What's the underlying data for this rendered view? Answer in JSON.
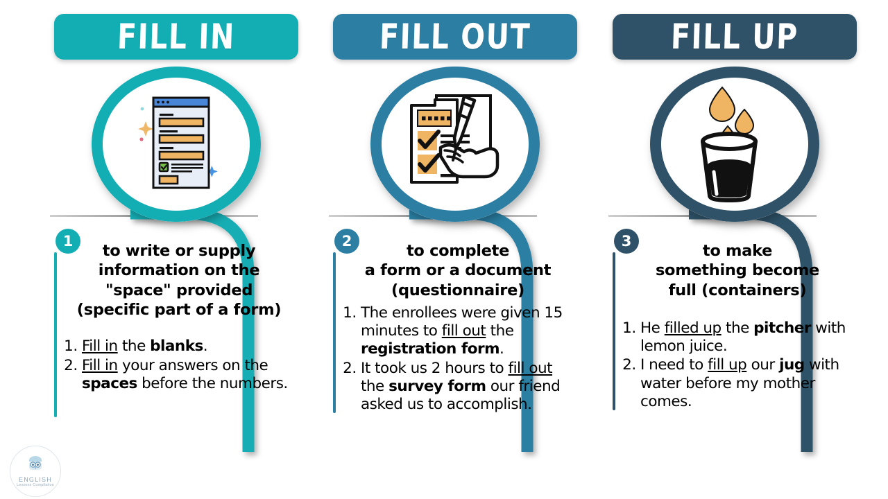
{
  "page": {
    "title": "Fill in / Fill out / Fill up",
    "background": "#ffffff"
  },
  "colors": {
    "teal": "#12AEB4",
    "blue": "#2C7FA3",
    "navy": "#2F5269",
    "orange": "#EFB562",
    "green": "#79C04A",
    "window_bar": "#4A86D8",
    "window_body": "#E8EEF8",
    "ink": "#000000",
    "rule_gray": "#9a9a9a"
  },
  "columns": [
    {
      "id": "fill-in",
      "header": "FILL IN",
      "accent": "#12AEB4",
      "number": "1",
      "icon": "online-form-window-icon",
      "definition": [
        "to write or supply",
        "information on the",
        "\"space\" provided",
        "(specific part of a form)"
      ],
      "examples": [
        {
          "parts": [
            {
              "t": "Fill in",
              "style": "underline"
            },
            {
              "t": " the ",
              "style": "plain"
            },
            {
              "t": "blanks",
              "style": "bold"
            },
            {
              "t": ".",
              "style": "plain"
            }
          ]
        },
        {
          "parts": [
            {
              "t": "Fill in",
              "style": "underline"
            },
            {
              "t": " your answers on the ",
              "style": "plain"
            },
            {
              "t": "spaces",
              "style": "bold"
            },
            {
              "t": " before the numbers.",
              "style": "plain"
            }
          ]
        }
      ]
    },
    {
      "id": "fill-out",
      "header": "FILL OUT",
      "accent": "#2C7FA3",
      "number": "2",
      "icon": "clipboard-hand-pen-icon",
      "definition": [
        "to complete",
        "a form or a document",
        "(questionnaire)"
      ],
      "examples": [
        {
          "parts": [
            {
              "t": "The enrollees were given 15 minutes to ",
              "style": "plain"
            },
            {
              "t": "fill out",
              "style": "underline"
            },
            {
              "t": " the ",
              "style": "plain"
            },
            {
              "t": "registration form",
              "style": "bold"
            },
            {
              "t": ".",
              "style": "plain"
            }
          ]
        },
        {
          "parts": [
            {
              "t": "It took us 2 hours to ",
              "style": "plain"
            },
            {
              "t": "fill out",
              "style": "underline"
            },
            {
              "t": " the ",
              "style": "plain"
            },
            {
              "t": "survey form",
              "style": "bold"
            },
            {
              "t": " our friend asked us to accomplish.",
              "style": "plain"
            }
          ]
        }
      ]
    },
    {
      "id": "fill-up",
      "header": "FILL UP",
      "accent": "#2F5269",
      "number": "3",
      "icon": "glass-filling-droplets-icon",
      "definition": [
        "to make",
        "something become",
        "full (containers)"
      ],
      "examples": [
        {
          "parts": [
            {
              "t": "He ",
              "style": "plain"
            },
            {
              "t": "filled up",
              "style": "underline"
            },
            {
              "t": " the ",
              "style": "plain"
            },
            {
              "t": "pitcher",
              "style": "bold"
            },
            {
              "t": " with lemon juice.",
              "style": "plain"
            }
          ]
        },
        {
          "parts": [
            {
              "t": "I need to ",
              "style": "plain"
            },
            {
              "t": "fill up",
              "style": "underline"
            },
            {
              "t": " our ",
              "style": "plain"
            },
            {
              "t": "jug",
              "style": "bold"
            },
            {
              "t": " with water before my mother comes.",
              "style": "plain"
            }
          ]
        }
      ]
    }
  ],
  "logo": {
    "mark": "owl-book-logo-icon",
    "line1": "ENGLISH",
    "line2": "Lessons Compilation"
  }
}
